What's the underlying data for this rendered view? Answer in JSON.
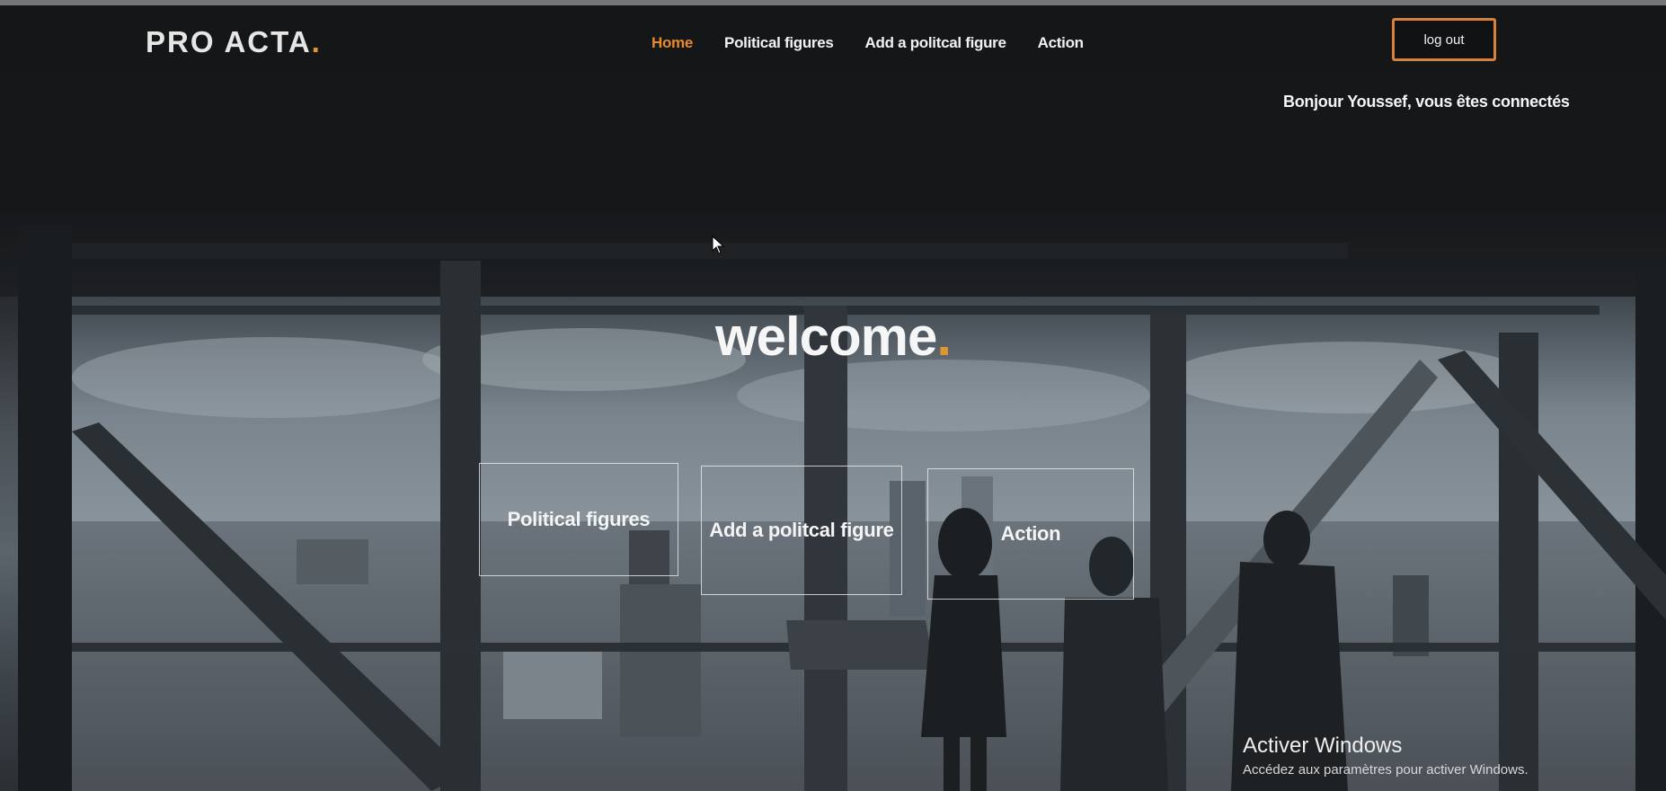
{
  "header": {
    "logo_text": "PRO ACTA",
    "logo_dot": ".",
    "nav": [
      {
        "label": "Home",
        "active": true
      },
      {
        "label": "Political figures",
        "active": false
      },
      {
        "label": "Add a politcal figure",
        "active": false
      },
      {
        "label": "Action",
        "active": false
      }
    ],
    "logout_label": "log out",
    "greeting": "Bonjour Youssef, vous êtes connectés"
  },
  "hero": {
    "title": "welcome",
    "title_dot": "."
  },
  "cards": [
    {
      "label": "Political figures"
    },
    {
      "label": "Add a politcal figure"
    },
    {
      "label": "Action"
    }
  ],
  "watermark": {
    "title": "Activer Windows",
    "subtitle": "Accédez aux paramètres pour activer Windows."
  },
  "colors": {
    "accent": "#e8892d",
    "text": "#f2f2f2",
    "background_dark": "#141618"
  },
  "icons": {
    "cursor": "mouse-pointer-icon"
  }
}
